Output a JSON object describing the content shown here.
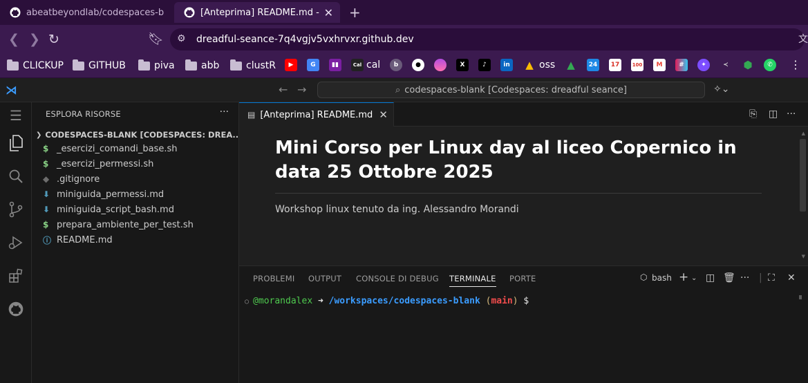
{
  "browser": {
    "tabs": [
      {
        "label": "abeatbeyondlab/codespaces-b"
      },
      {
        "label": "[Anteprima] README.md -",
        "close": "✕"
      }
    ],
    "new_tab": "+",
    "url": "dreadful-seance-7q4vgjv5vxhrvxr.github.dev",
    "bookmarks": [
      {
        "label": "CLICKUP",
        "type": "folder"
      },
      {
        "label": "GITHUB",
        "type": "folder"
      },
      {
        "label": "piva",
        "type": "folder"
      },
      {
        "label": "abb",
        "type": "folder"
      },
      {
        "label": "clustR",
        "type": "folder"
      },
      {
        "label": "cal",
        "type": "link"
      },
      {
        "label": "oss",
        "type": "link"
      }
    ],
    "bookmark_icons": [
      "youtube-icon",
      "translate-icon",
      "trello-icon",
      "cal-icon",
      "beyond-icon",
      "github-icon",
      "sunset-icon",
      "x-icon",
      "tiktok-icon",
      "linkedin-icon",
      "drive-icon",
      "drive-icon",
      "calendar-icon",
      "calendar-icon",
      "calendar-icon",
      "gmail-icon",
      "slack-icon",
      "star-icon",
      "share-icon",
      "maps-icon",
      "whatsapp-icon"
    ]
  },
  "vscode": {
    "command_center": "codespaces-blank [Codespaces: dreadful seance]",
    "explorer": {
      "title": "ESPLORA RISORSE",
      "folder": "CODESPACES-BLANK [CODESPACES: DREA...",
      "files": [
        {
          "name": "_esercizi_comandi_base.sh",
          "icon": "$",
          "color": "#89d185"
        },
        {
          "name": "_esercizi_permessi.sh",
          "icon": "$",
          "color": "#89d185"
        },
        {
          "name": ".gitignore",
          "icon": "◆",
          "color": "#6d6d6d"
        },
        {
          "name": "miniguida_permessi.md",
          "icon": "⬇",
          "color": "#519aba"
        },
        {
          "name": "miniguida_script_bash.md",
          "icon": "⬇",
          "color": "#519aba"
        },
        {
          "name": "prepara_ambiente_per_test.sh",
          "icon": "$",
          "color": "#89d185"
        },
        {
          "name": "README.md",
          "icon": "ⓘ",
          "color": "#519aba"
        }
      ]
    },
    "editor_tab": "[Anteprima] README.md",
    "preview": {
      "title": "Mini Corso per Linux day al liceo Copernico in data 25 Ottobre 2025",
      "body": "Workshop linux tenuto da ing. Alessandro Morandi"
    },
    "panel": {
      "tabs": [
        "PROBLEMI",
        "OUTPUT",
        "CONSOLE DI DEBUG",
        "TERMINALE",
        "PORTE"
      ],
      "active_tab": "TERMINALE",
      "terminal_name": "bash",
      "prompt": {
        "user": "@morandalex",
        "arrow": " ➜ ",
        "path": "/workspaces/codespaces-blank",
        "branch_open": " (",
        "branch": "main",
        "branch_close": ")",
        "dollar": " $"
      }
    }
  },
  "colors": {
    "browser_bg": "#2b0f3a",
    "toolbar_bg": "#3b1a4f",
    "vscode_accent": "#0078d4"
  }
}
